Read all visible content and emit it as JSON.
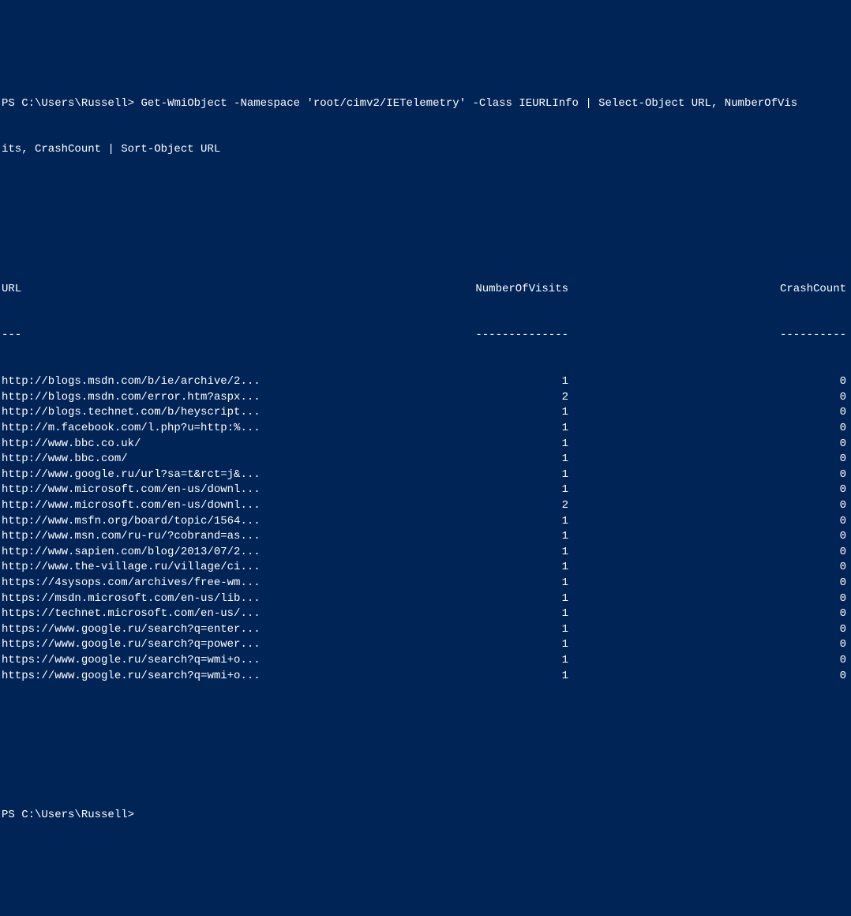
{
  "prompt1_prefix": "PS C:\\Users\\Russell> ",
  "command": "Get-WmiObject -Namespace 'root/cimv2/IETelemetry' -Class IEURLInfo | Select-Object URL, NumberOfVis",
  "command_wrap": "its, CrashCount | Sort-Object URL",
  "headers": {
    "url": "URL",
    "visits": "NumberOfVisits",
    "crash": "CrashCount"
  },
  "dividers": {
    "url": "---",
    "visits": "--------------",
    "crash": "----------"
  },
  "chart_data": {
    "type": "table",
    "columns": [
      "URL",
      "NumberOfVisits",
      "CrashCount"
    ],
    "rows": [
      {
        "url": "http://blogs.msdn.com/b/ie/archive/2...",
        "visits": 1,
        "crash": 0
      },
      {
        "url": "http://blogs.msdn.com/error.htm?aspx...",
        "visits": 2,
        "crash": 0
      },
      {
        "url": "http://blogs.technet.com/b/heyscript...",
        "visits": 1,
        "crash": 0
      },
      {
        "url": "http://m.facebook.com/l.php?u=http:%...",
        "visits": 1,
        "crash": 0
      },
      {
        "url": "http://www.bbc.co.uk/",
        "visits": 1,
        "crash": 0
      },
      {
        "url": "http://www.bbc.com/",
        "visits": 1,
        "crash": 0
      },
      {
        "url": "http://www.google.ru/url?sa=t&rct=j&...",
        "visits": 1,
        "crash": 0
      },
      {
        "url": "http://www.microsoft.com/en-us/downl...",
        "visits": 1,
        "crash": 0
      },
      {
        "url": "http://www.microsoft.com/en-us/downl...",
        "visits": 2,
        "crash": 0
      },
      {
        "url": "http://www.msfn.org/board/topic/1564...",
        "visits": 1,
        "crash": 0
      },
      {
        "url": "http://www.msn.com/ru-ru/?cobrand=as...",
        "visits": 1,
        "crash": 0
      },
      {
        "url": "http://www.sapien.com/blog/2013/07/2...",
        "visits": 1,
        "crash": 0
      },
      {
        "url": "http://www.the-village.ru/village/ci...",
        "visits": 1,
        "crash": 0
      },
      {
        "url": "https://4sysops.com/archives/free-wm...",
        "visits": 1,
        "crash": 0
      },
      {
        "url": "https://msdn.microsoft.com/en-us/lib...",
        "visits": 1,
        "crash": 0
      },
      {
        "url": "https://technet.microsoft.com/en-us/...",
        "visits": 1,
        "crash": 0
      },
      {
        "url": "https://www.google.ru/search?q=enter...",
        "visits": 1,
        "crash": 0
      },
      {
        "url": "https://www.google.ru/search?q=power...",
        "visits": 1,
        "crash": 0
      },
      {
        "url": "https://www.google.ru/search?q=wmi+o...",
        "visits": 1,
        "crash": 0
      },
      {
        "url": "https://www.google.ru/search?q=wmi+o...",
        "visits": 1,
        "crash": 0
      }
    ]
  },
  "prompt2": "PS C:\\Users\\Russell>"
}
